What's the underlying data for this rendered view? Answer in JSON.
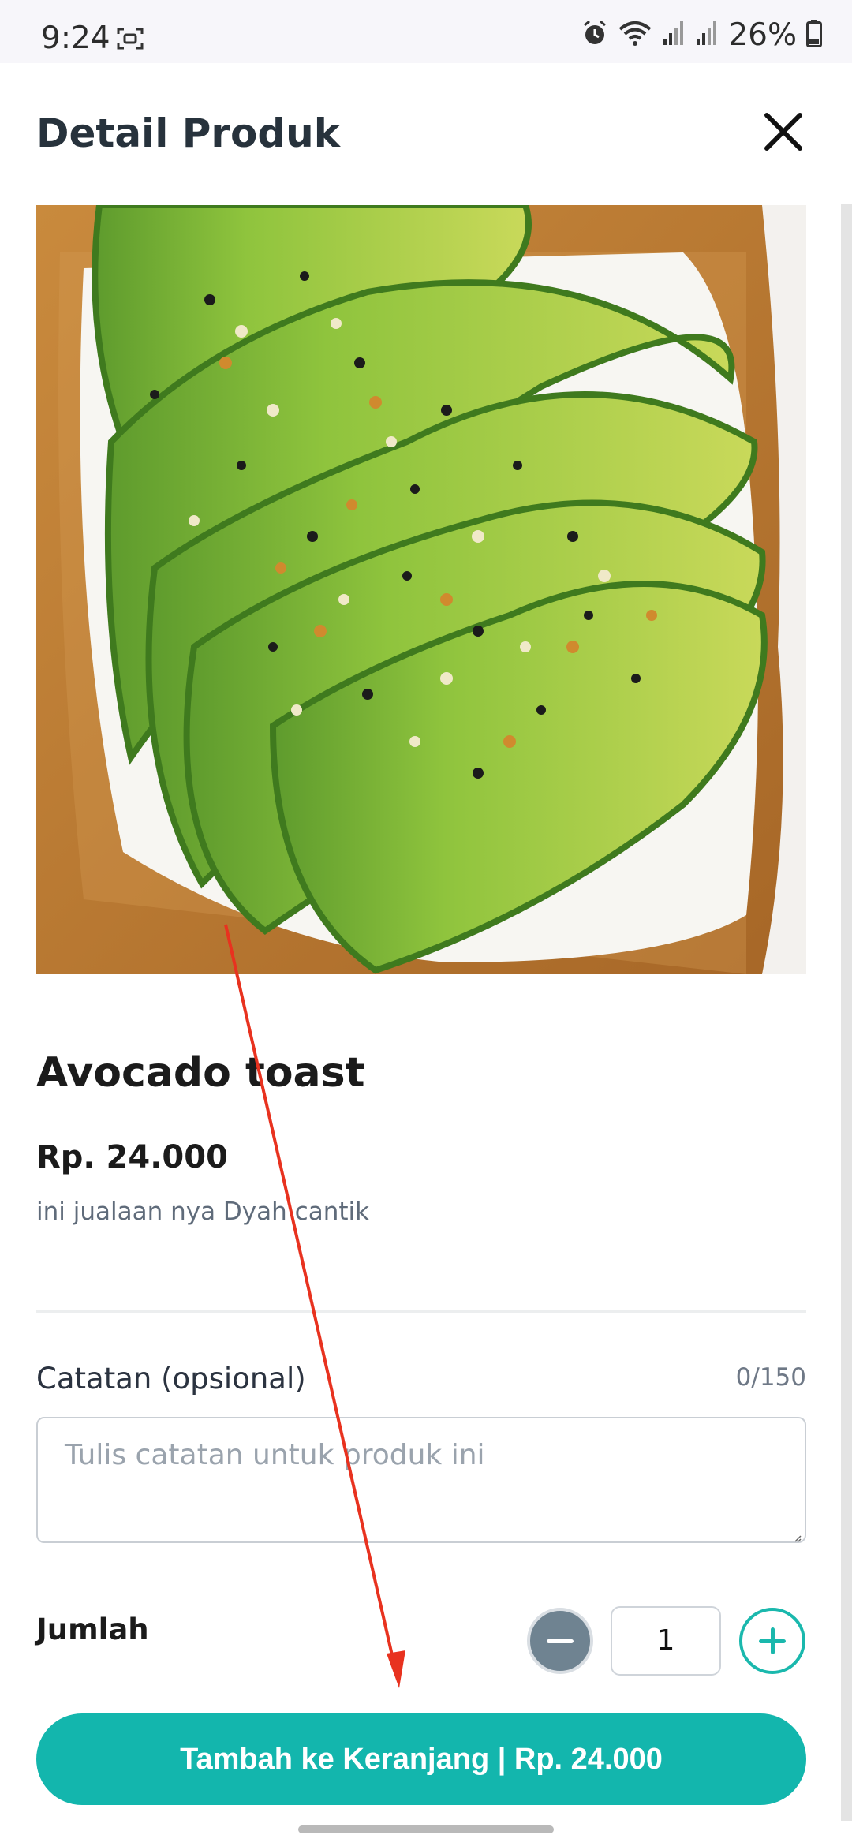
{
  "status_bar": {
    "time": "9:24",
    "battery_percent": "26%",
    "icons": [
      "screen-record-icon",
      "alarm-icon",
      "wifi-icon",
      "signal-icon",
      "signal-icon",
      "battery-icon"
    ]
  },
  "header": {
    "title": "Detail Produk",
    "close_icon": "close-icon"
  },
  "product": {
    "image": "avocado-toast-photo",
    "name": "Avocado toast",
    "price": "Rp. 24.000",
    "description": "ini jualaan nya Dyah cantik"
  },
  "notes": {
    "label": "Catatan (opsional)",
    "counter": "0/150",
    "value": "",
    "placeholder": "Tulis catatan untuk produk ini"
  },
  "quantity": {
    "label": "Jumlah",
    "value": "1",
    "minus_icon": "minus-icon",
    "plus_icon": "plus-icon"
  },
  "cta": {
    "label": "Tambah ke Keranjang | Rp. 24.000"
  },
  "colors": {
    "accent": "#13b6ad",
    "annotation_arrow": "#e8321f"
  }
}
